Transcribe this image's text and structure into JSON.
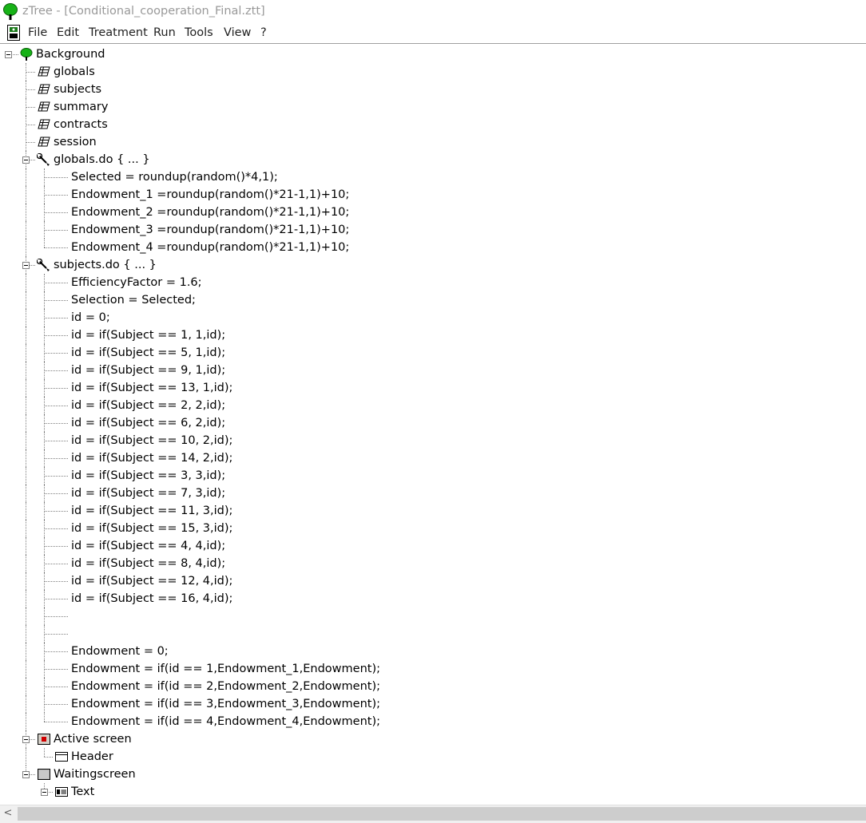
{
  "window": {
    "title": "zTree - [Conditional_cooperation_Final.ztt]"
  },
  "menu": {
    "items": [
      "File",
      "Edit",
      "Treatment",
      "Run",
      "Tools",
      "View",
      "?"
    ]
  },
  "tree": {
    "nodes": [
      {
        "level": 0,
        "icon": "tree-icon",
        "label": "Background",
        "expanded": true
      },
      {
        "level": 1,
        "icon": "table-icon",
        "label": "globals"
      },
      {
        "level": 1,
        "icon": "table-icon",
        "label": "subjects"
      },
      {
        "level": 1,
        "icon": "table-icon",
        "label": "summary"
      },
      {
        "level": 1,
        "icon": "table-icon",
        "label": "contracts"
      },
      {
        "level": 1,
        "icon": "table-icon",
        "label": "session"
      },
      {
        "level": 1,
        "icon": "program-icon",
        "label": "globals.do {  ... }",
        "expanded": true
      },
      {
        "level": 2,
        "label": "Selected = roundup(random()*4,1);"
      },
      {
        "level": 2,
        "label": "Endowment_1 =roundup(random()*21-1,1)+10;"
      },
      {
        "level": 2,
        "label": "Endowment_2 =roundup(random()*21-1,1)+10;"
      },
      {
        "level": 2,
        "label": "Endowment_3 =roundup(random()*21-1,1)+10;"
      },
      {
        "level": 2,
        "label": "Endowment_4 =roundup(random()*21-1,1)+10;"
      },
      {
        "level": 1,
        "icon": "program-icon",
        "label": "subjects.do {  ... }",
        "expanded": true
      },
      {
        "level": 2,
        "label": "EfficiencyFactor = 1.6;"
      },
      {
        "level": 2,
        "label": "Selection = Selected;"
      },
      {
        "level": 2,
        "label": "id = 0;"
      },
      {
        "level": 2,
        "label": "id = if(Subject == 1, 1,id);"
      },
      {
        "level": 2,
        "label": "id = if(Subject == 5, 1,id);"
      },
      {
        "level": 2,
        "label": "id = if(Subject == 9, 1,id);"
      },
      {
        "level": 2,
        "label": "id = if(Subject == 13, 1,id);"
      },
      {
        "level": 2,
        "label": "id = if(Subject == 2, 2,id);"
      },
      {
        "level": 2,
        "label": "id = if(Subject == 6, 2,id);"
      },
      {
        "level": 2,
        "label": "id = if(Subject == 10, 2,id);"
      },
      {
        "level": 2,
        "label": "id = if(Subject == 14, 2,id);"
      },
      {
        "level": 2,
        "label": "id = if(Subject == 3, 3,id);"
      },
      {
        "level": 2,
        "label": "id = if(Subject == 7, 3,id);"
      },
      {
        "level": 2,
        "label": "id = if(Subject == 11, 3,id);"
      },
      {
        "level": 2,
        "label": "id = if(Subject == 15, 3,id);"
      },
      {
        "level": 2,
        "label": "id = if(Subject == 4, 4,id);"
      },
      {
        "level": 2,
        "label": "id = if(Subject == 8, 4,id);"
      },
      {
        "level": 2,
        "label": "id = if(Subject == 12, 4,id);"
      },
      {
        "level": 2,
        "label": "id = if(Subject == 16, 4,id);"
      },
      {
        "level": 2,
        "label": ""
      },
      {
        "level": 2,
        "label": ""
      },
      {
        "level": 2,
        "label": "Endowment = 0;"
      },
      {
        "level": 2,
        "label": "Endowment = if(id == 1,Endowment_1,Endowment);"
      },
      {
        "level": 2,
        "label": "Endowment = if(id == 2,Endowment_2,Endowment);"
      },
      {
        "level": 2,
        "label": "Endowment = if(id == 3,Endowment_3,Endowment);"
      },
      {
        "level": 2,
        "label": "Endowment = if(id == 4,Endowment_4,Endowment);"
      },
      {
        "level": 1,
        "icon": "active-screen-icon",
        "label": "Active screen",
        "expanded": true
      },
      {
        "level": 2,
        "icon": "box-icon",
        "label": "Header"
      },
      {
        "level": 1,
        "icon": "waiting-screen-icon",
        "label": "Waitingscreen",
        "expanded": true
      },
      {
        "level": 2,
        "icon": "text-box-icon",
        "label": "Text",
        "expanded": true
      }
    ]
  },
  "scrollbar": {
    "left_arrow": "<"
  }
}
